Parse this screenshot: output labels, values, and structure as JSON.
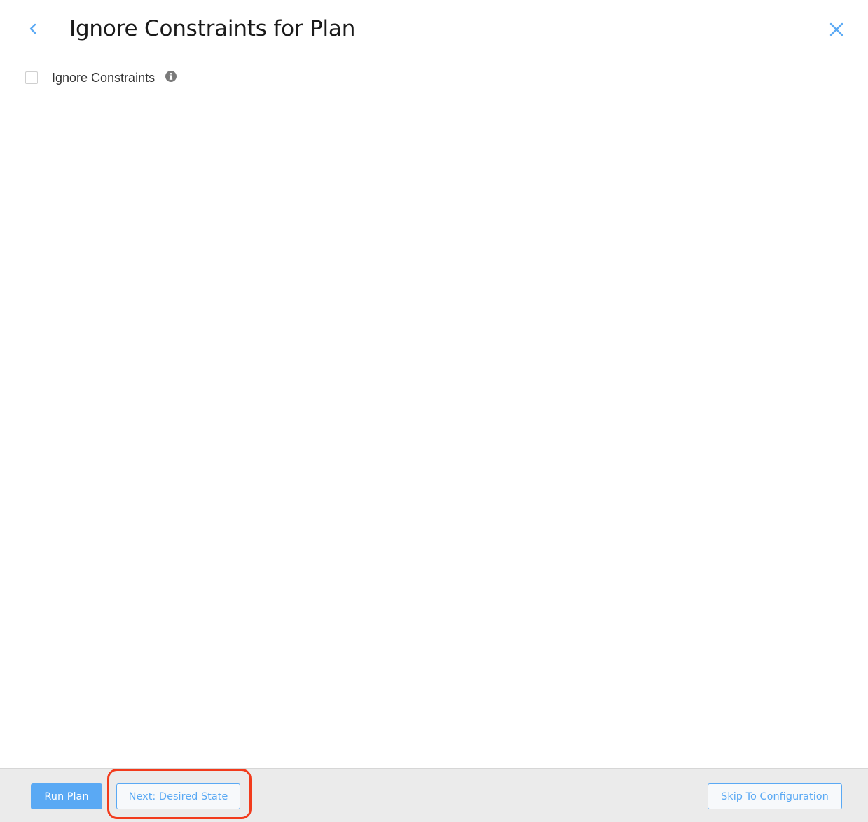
{
  "header": {
    "title": "Ignore Constraints for Plan",
    "back_icon": "chevron-left-icon",
    "close_icon": "close-icon"
  },
  "options": {
    "ignore_constraints": {
      "label": "Ignore Constraints",
      "checked": false,
      "info_icon": "info-icon"
    }
  },
  "footer": {
    "run_plan_label": "Run Plan",
    "next_label": "Next: Desired State",
    "skip_label": "Skip To Configuration"
  },
  "colors": {
    "accent": "#5aa9f4",
    "footer_bg": "#ebebeb",
    "highlight": "#f23b1c"
  }
}
